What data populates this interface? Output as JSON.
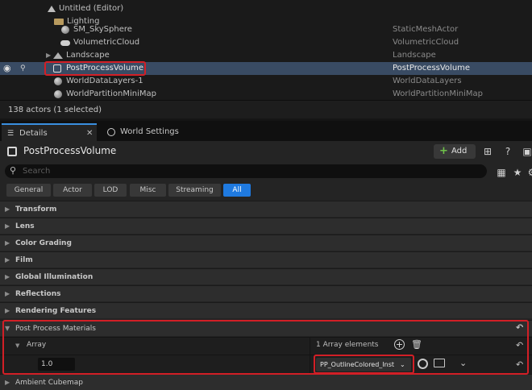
{
  "outliner": {
    "rows": [
      {
        "name": "Untitled (Editor)",
        "type": ""
      },
      {
        "name": "Lighting",
        "type": ""
      },
      {
        "name": "SM_SkySphere",
        "type": "StaticMeshActor"
      },
      {
        "name": "VolumetricCloud",
        "type": "VolumetricCloud"
      },
      {
        "name": "Landscape",
        "type": "Landscape"
      },
      {
        "name": "PostProcessVolume",
        "type": "PostProcessVolume"
      },
      {
        "name": "WorldDataLayers-1",
        "type": "WorldDataLayers"
      },
      {
        "name": "WorldPartitionMiniMap",
        "type": "WorldPartitionMiniMap"
      }
    ],
    "footer": "138 actors (1 selected)"
  },
  "tabs": {
    "details": "Details",
    "world_settings": "World Settings"
  },
  "details": {
    "actor_name": "PostProcessVolume",
    "add_label": "Add",
    "search_placeholder": "Search",
    "filters": [
      "General",
      "Actor",
      "LOD",
      "Misc",
      "Streaming",
      "All"
    ],
    "active_filter": "All",
    "categories": [
      "Transform",
      "Lens",
      "Color Grading",
      "Film",
      "Global Illumination",
      "Reflections",
      "Rendering Features",
      "Post Process Materials"
    ],
    "array_label": "Array",
    "array_count": "1 Array elements",
    "weight_value": "1.0",
    "material_value": "PP_OutlineColored_Inst",
    "last_category": "Ambient Cubemap"
  },
  "colors": {
    "accent": "#1f7ae0",
    "selection": "#394b63",
    "highlight": "#d21f26",
    "panel": "#242424"
  }
}
